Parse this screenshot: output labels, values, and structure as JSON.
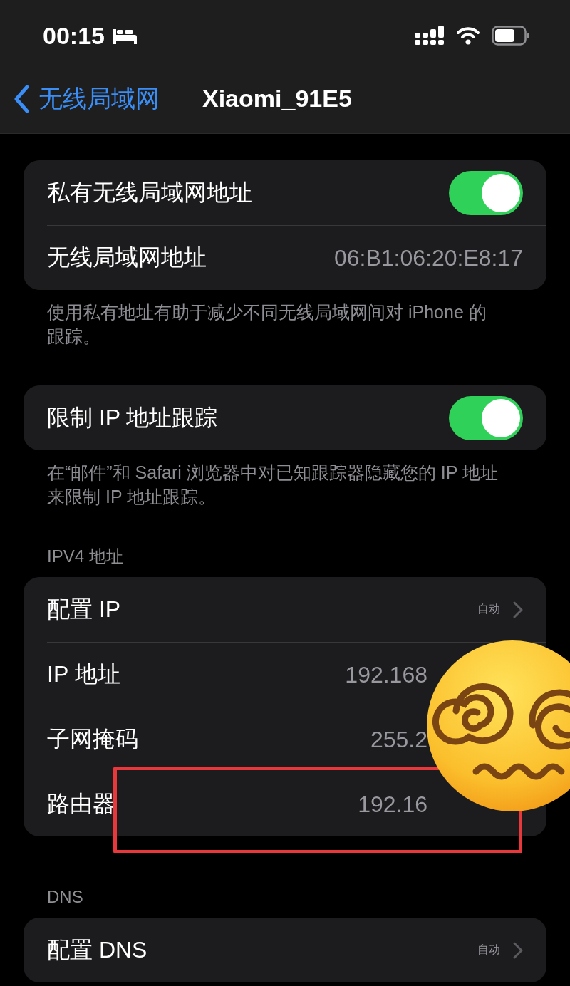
{
  "status_bar": {
    "time": "00:15"
  },
  "nav": {
    "back": "无线局域网",
    "title": "Xiaomi_91E5"
  },
  "sections": [
    {
      "rows": [
        {
          "kind": "toggle",
          "label": "私有无线局域网地址",
          "on": true
        },
        {
          "kind": "value",
          "label": "无线局域网地址",
          "value": "06:B1:06:20:E8:17"
        }
      ],
      "footer": "使用私有地址有助于减少不同无线局域网间对 iPhone 的跟踪。"
    },
    {
      "rows": [
        {
          "kind": "toggle",
          "label": "限制 IP 地址跟踪",
          "on": true
        }
      ],
      "footer": "在“邮件”和 Safari 浏览器中对已知跟踪器隐藏您的 IP 地址来限制 IP 地址跟踪。"
    },
    {
      "header": "IPV4 地址",
      "rows": [
        {
          "kind": "link",
          "label": "配置 IP",
          "value": "自动"
        },
        {
          "kind": "value",
          "label": "IP 地址",
          "value": "192.168"
        },
        {
          "kind": "value",
          "label": "子网掩码",
          "value": "255.2"
        },
        {
          "kind": "value",
          "label": "路由器",
          "value": "192.16"
        }
      ]
    },
    {
      "header": "DNS",
      "rows": [
        {
          "kind": "link",
          "label": "配置 DNS",
          "value": "自动"
        }
      ]
    }
  ]
}
